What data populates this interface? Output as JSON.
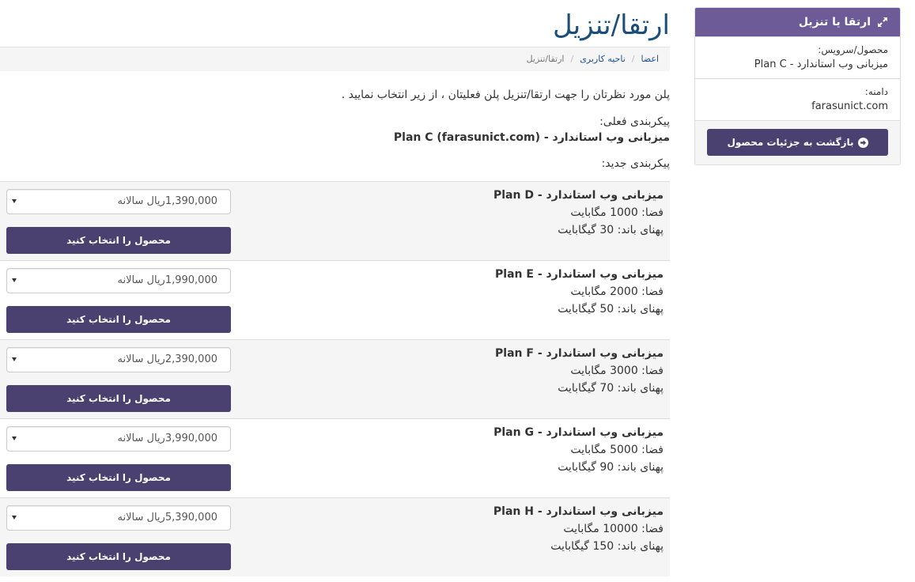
{
  "colors": {
    "panel_heading": "#6d5b97",
    "button": "#4a4170",
    "page_title": "#1b4f7a",
    "link": "#1d4f91",
    "row_stripe": "#f5f5f5"
  },
  "page": {
    "title": "ارتقا/تنزیل"
  },
  "breadcrumb": {
    "separator": "/",
    "items": [
      {
        "label": "اعضا"
      },
      {
        "label": "ناحیه کاربری"
      },
      {
        "label": "ارتقا/تنزیل"
      }
    ]
  },
  "intro": "پلن مورد نظرتان را جهت ارتقا/تنزیل پلن فعلیتان ، از زیر انتخاب نمایید .",
  "current_config": {
    "label": "پیکربندی فعلی:",
    "value": "میزبانی وب استاندارد - Plan C (farasunict.com)"
  },
  "new_config": {
    "label": "پیکربندی جدید:"
  },
  "plans_table": {
    "choose_label": "محصول را انتخاب کنید",
    "dropdown_icon": "dropdown-caret-icon",
    "plans": [
      {
        "name": "میزبانی وب استاندارد - Plan D",
        "space": "فضا: 1000 مگابایت",
        "bandwidth": "پهنای باند: 30 گیگابایت",
        "price": "1,390,000ریال سالانه"
      },
      {
        "name": "میزبانی وب استاندارد - Plan E",
        "space": "فضا: 2000 مگابایت",
        "bandwidth": "پهنای باند: 50 گیگابایت",
        "price": "1,990,000ریال سالانه"
      },
      {
        "name": "میزبانی وب استاندارد - Plan F",
        "space": "فضا: 3000 مگابایت",
        "bandwidth": "پهنای باند: 70 گیگابایت",
        "price": "2,390,000ریال سالانه"
      },
      {
        "name": "میزبانی وب استاندارد - Plan G",
        "space": "فضا: 5000 مگابایت",
        "bandwidth": "پهنای باند: 90 گیگابایت",
        "price": "3,990,000ریال سالانه"
      },
      {
        "name": "میزبانی وب استاندارد - Plan H",
        "space": "فضا: 10000 مگابایت",
        "bandwidth": "پهنای باند: 150 گیگابایت",
        "price": "5,390,000ریال سالانه"
      }
    ]
  },
  "sidebar": {
    "title": "ارتقا یا تنزیل",
    "title_icon": "expand-arrows-icon",
    "product_label": "محصول/سرویس:",
    "product_value": "میزبانی وب استاندارد - Plan C",
    "domain_label": "دامنه:",
    "domain_value": "farasunict.com",
    "back_button": "بازگشت به جزئیات محصول",
    "back_icon": "arrow-circle-right-icon"
  }
}
